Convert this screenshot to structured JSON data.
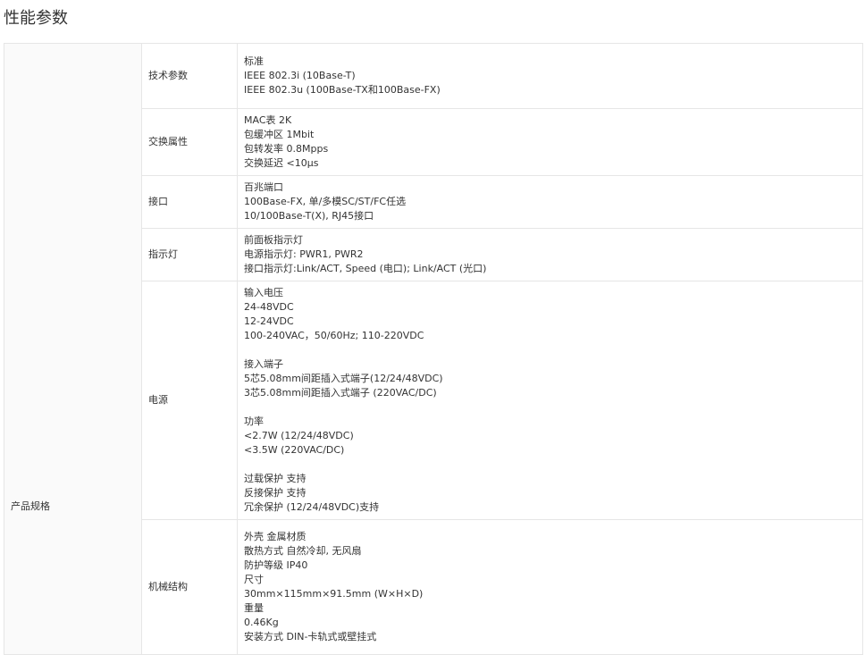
{
  "page": {
    "title": "性能参数"
  },
  "table": {
    "group_label": "产品规格",
    "rows": [
      {
        "param": "技术参数",
        "lines": [
          "标准",
          "IEEE 802.3i (10Base-T)",
          "IEEE 802.3u (100Base-TX和100Base-FX)"
        ]
      },
      {
        "param": "交换属性",
        "lines": [
          "MAC表 2K",
          "包缓冲区 1Mbit",
          "包转发率 0.8Mpps",
          "交换延迟 <10μs"
        ]
      },
      {
        "param": "接口",
        "lines": [
          "百兆端口",
          "100Base-FX, 单/多模SC/ST/FC任选",
          "10/100Base-T(X), RJ45接口"
        ]
      },
      {
        "param": "指示灯",
        "lines": [
          "前面板指示灯",
          "电源指示灯: PWR1, PWR2",
          "接口指示灯:Link/ACT, Speed (电口); Link/ACT (光口)"
        ]
      },
      {
        "param": "电源",
        "lines": [
          "输入电压",
          "24-48VDC",
          "12-24VDC",
          "100-240VAC，50/60Hz; 110-220VDC",
          "",
          "接入端子",
          "5芯5.08mm间距插入式端子(12/24/48VDC)",
          "3芯5.08mm间距插入式端子 (220VAC/DC)",
          "",
          "功率",
          "<2.7W (12/24/48VDC)",
          "<3.5W (220VAC/DC)",
          "",
          "过载保护 支持",
          "反接保护 支持",
          "冗余保护 (12/24/48VDC)支持"
        ]
      },
      {
        "param": "机械结构",
        "lines": [
          "外壳 金属材质",
          "散热方式 自然冷却, 无风扇",
          "防护等级 IP40",
          "尺寸",
          "30mm×115mm×91.5mm (W×H×D)",
          "重量",
          "0.46Kg",
          "安装方式 DIN-卡轨式或壁挂式"
        ]
      }
    ]
  }
}
